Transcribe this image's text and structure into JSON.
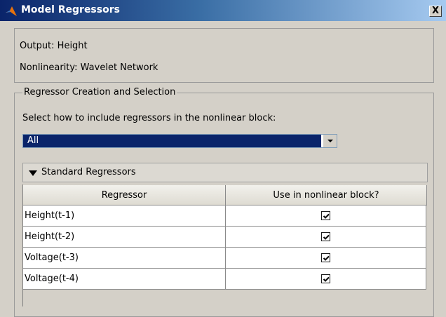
{
  "window": {
    "title": "Model Regressors",
    "close_glyph": "X",
    "icon": "matlab-logo-icon"
  },
  "info": {
    "output": "Output: Height",
    "nonlinearity": "Nonlinearity: Wavelet Network"
  },
  "group": {
    "legend": "Regressor Creation and Selection",
    "prompt": "Select how to include regressors in the nonlinear block:",
    "select_value": "All"
  },
  "section": {
    "title": "Standard Regressors",
    "expanded": true
  },
  "table": {
    "columns": [
      "Regressor",
      "Use in nonlinear block?"
    ],
    "rows": [
      {
        "regressor": "Height(t-1)",
        "checked": true
      },
      {
        "regressor": "Height(t-2)",
        "checked": true
      },
      {
        "regressor": "Voltage(t-3)",
        "checked": true
      },
      {
        "regressor": "Voltage(t-4)",
        "checked": true
      }
    ]
  },
  "colors": {
    "titlebar_start": "#0a246a",
    "titlebar_end": "#a6caf0",
    "selection": "#0a246a",
    "window_bg": "#d4d0c8"
  }
}
